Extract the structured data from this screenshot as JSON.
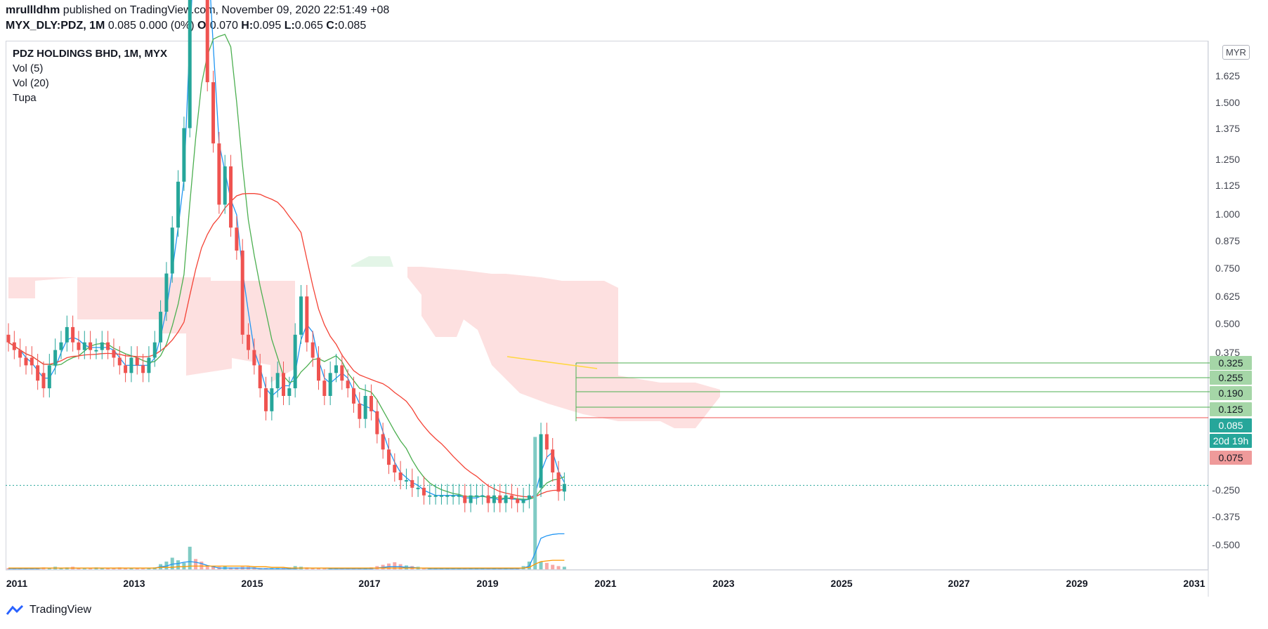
{
  "header": {
    "author": "mrullldhm",
    "published_text": "published on TradingView.com, November 09, 2020 22:51:49 +08",
    "symbol_line": "MYX_DLY:PDZ, 1M",
    "quote": "0.085 0.000 (0%)",
    "open_label": "O:",
    "open": "0.070",
    "high_label": "H:",
    "high": "0.095",
    "low_label": "L:",
    "low": "0.065",
    "close_label": "C:",
    "close": "0.085"
  },
  "legend": {
    "title": "PDZ HOLDINGS BHD, 1M, MYX",
    "vol5": "Vol (5)",
    "vol20": "Vol (20)",
    "indicator": "Tupa"
  },
  "currency_button": "MYR",
  "brand": "TradingView",
  "colors": {
    "up": "#26a69a",
    "down": "#ef5350",
    "ma_fast": "#2196f3",
    "ma_mid": "#4caf50",
    "ma_slow": "#f44336",
    "cloud_red": "#fde0e0",
    "cloud_green": "#e3f5e7",
    "level_line": "#4caf50",
    "yellow": "#ffd740"
  },
  "chart_data": {
    "type": "candlestick",
    "x_ticks": [
      "2011",
      "2013",
      "2015",
      "2017",
      "2019",
      "2021",
      "2023",
      "2025",
      "2027",
      "2029",
      "2031"
    ],
    "y_ticks": [
      "1.625",
      "1.500",
      "1.375",
      "1.250",
      "1.125",
      "1.000",
      "0.875",
      "0.750",
      "0.625",
      "0.500",
      "0.375",
      "-0.250",
      "-0.375",
      "-0.500"
    ],
    "price_labels": [
      {
        "value": "0.325",
        "kind": "level"
      },
      {
        "value": "0.255",
        "kind": "level"
      },
      {
        "value": "0.190",
        "kind": "level"
      },
      {
        "value": "0.125",
        "kind": "level"
      },
      {
        "value": "0.085",
        "kind": "last"
      },
      {
        "value": "20d 19h",
        "kind": "countdown"
      },
      {
        "value": "0.075",
        "kind": "red"
      }
    ],
    "fib_levels": [
      0.325,
      0.255,
      0.19,
      0.125
    ],
    "last_price": 0.085,
    "red_level": 0.075,
    "series": [
      {
        "name": "Price",
        "values": [
          [
            0.28,
            0.27
          ],
          [
            0.27,
            0.26
          ],
          [
            0.26,
            0.25
          ],
          [
            0.25,
            0.24
          ],
          [
            0.25,
            0.24
          ],
          [
            0.24,
            0.22
          ],
          [
            0.23,
            0.21
          ],
          [
            0.21,
            0.24
          ],
          [
            0.24,
            0.26
          ],
          [
            0.26,
            0.27
          ],
          [
            0.27,
            0.29
          ],
          [
            0.29,
            0.27
          ],
          [
            0.27,
            0.26
          ],
          [
            0.26,
            0.27
          ],
          [
            0.27,
            0.26
          ],
          [
            0.26,
            0.26
          ],
          [
            0.26,
            0.27
          ],
          [
            0.27,
            0.26
          ],
          [
            0.26,
            0.25
          ],
          [
            0.25,
            0.24
          ],
          [
            0.24,
            0.23
          ],
          [
            0.23,
            0.25
          ],
          [
            0.25,
            0.24
          ],
          [
            0.24,
            0.23
          ],
          [
            0.23,
            0.25
          ],
          [
            0.25,
            0.27
          ],
          [
            0.27,
            0.31
          ],
          [
            0.31,
            0.36
          ],
          [
            0.36,
            0.42
          ],
          [
            0.42,
            0.48
          ],
          [
            0.48,
            0.55
          ],
          [
            0.55,
            0.97
          ],
          [
            1.02,
            0.94
          ],
          [
            0.94,
            0.83
          ],
          [
            0.83,
            0.61
          ],
          [
            0.61,
            0.53
          ],
          [
            0.53,
            0.45
          ],
          [
            0.45,
            0.5
          ],
          [
            0.5,
            0.42
          ],
          [
            0.42,
            0.39
          ],
          [
            0.39,
            0.28
          ],
          [
            0.28,
            0.26
          ],
          [
            0.26,
            0.24
          ],
          [
            0.24,
            0.21
          ],
          [
            0.21,
            0.18
          ],
          [
            0.18,
            0.21
          ],
          [
            0.21,
            0.23
          ],
          [
            0.23,
            0.2
          ],
          [
            0.2,
            0.21
          ],
          [
            0.21,
            0.28
          ],
          [
            0.28,
            0.33
          ],
          [
            0.33,
            0.27
          ],
          [
            0.27,
            0.25
          ],
          [
            0.25,
            0.22
          ],
          [
            0.22,
            0.2
          ],
          [
            0.2,
            0.23
          ],
          [
            0.23,
            0.24
          ],
          [
            0.24,
            0.22
          ],
          [
            0.22,
            0.21
          ],
          [
            0.21,
            0.19
          ],
          [
            0.19,
            0.17
          ],
          [
            0.17,
            0.2
          ],
          [
            0.2,
            0.18
          ],
          [
            0.18,
            0.15
          ],
          [
            0.15,
            0.13
          ],
          [
            0.13,
            0.11
          ],
          [
            0.11,
            0.1
          ],
          [
            0.1,
            0.09
          ],
          [
            0.09,
            0.09
          ],
          [
            0.09,
            0.08
          ],
          [
            0.08,
            0.08
          ],
          [
            0.08,
            0.07
          ],
          [
            0.07,
            0.07
          ],
          [
            0.07,
            0.07
          ],
          [
            0.07,
            0.07
          ],
          [
            0.07,
            0.07
          ],
          [
            0.07,
            0.07
          ],
          [
            0.07,
            0.07
          ],
          [
            0.07,
            0.06
          ],
          [
            0.06,
            0.07
          ],
          [
            0.07,
            0.07
          ],
          [
            0.07,
            0.07
          ],
          [
            0.07,
            0.06
          ],
          [
            0.06,
            0.07
          ],
          [
            0.07,
            0.06
          ],
          [
            0.06,
            0.07
          ],
          [
            0.07,
            0.065
          ],
          [
            0.065,
            0.06
          ],
          [
            0.06,
            0.065
          ],
          [
            0.065,
            0.07
          ],
          [
            0.07,
            0.08
          ],
          [
            0.08,
            0.15
          ],
          [
            0.15,
            0.13
          ],
          [
            0.13,
            0.1
          ],
          [
            0.1,
            0.075
          ],
          [
            0.075,
            0.085
          ]
        ]
      },
      {
        "name": "Vol (5)",
        "values": [
          0.01,
          0.01,
          0.01,
          0.01,
          0.01,
          0.01,
          0.02,
          0.02,
          0.02,
          0.02,
          0.02,
          0.02,
          0.02,
          0.02,
          0.02,
          0.02,
          0.02,
          0.02,
          0.02,
          0.02,
          0.02,
          0.02,
          0.02,
          0.02,
          0.02,
          0.02,
          0.04,
          0.05,
          0.08,
          0.09,
          0.11,
          0.12,
          0.11,
          0.09,
          0.06,
          0.04,
          0.02,
          0.02,
          0.02,
          0.02,
          0.02,
          0.02,
          0.02,
          0.01,
          0.01,
          0.01,
          0.01,
          0.01,
          0.01,
          0.01,
          0.02,
          0.02,
          0.02,
          0.02,
          0.02,
          0.01,
          0.01,
          0.01,
          0.01,
          0.01,
          0.01,
          0.01,
          0.01,
          0.02,
          0.03,
          0.04,
          0.04,
          0.04,
          0.03,
          0.03,
          0.02,
          0.02,
          0.01,
          0.01,
          0.01,
          0.01,
          0.01,
          0.01,
          0.01,
          0.01,
          0.01,
          0.01,
          0.01,
          0.01,
          0.01,
          0.01,
          0.01,
          0.01,
          0.02,
          0.05,
          0.25,
          0.48,
          0.52,
          0.54,
          0.55,
          0.55
        ]
      },
      {
        "name": "Vol (20)",
        "values": [
          0.02,
          0.02,
          0.02,
          0.02,
          0.02,
          0.02,
          0.02,
          0.02,
          0.02,
          0.02,
          0.02,
          0.02,
          0.02,
          0.02,
          0.02,
          0.02,
          0.02,
          0.02,
          0.02,
          0.02,
          0.02,
          0.02,
          0.02,
          0.02,
          0.02,
          0.02,
          0.03,
          0.03,
          0.03,
          0.04,
          0.04,
          0.05,
          0.05,
          0.05,
          0.05,
          0.05,
          0.05,
          0.05,
          0.05,
          0.05,
          0.05,
          0.05,
          0.04,
          0.04,
          0.04,
          0.03,
          0.03,
          0.03,
          0.02,
          0.02,
          0.02,
          0.02,
          0.02,
          0.02,
          0.02,
          0.02,
          0.02,
          0.02,
          0.02,
          0.02,
          0.02,
          0.02,
          0.02,
          0.02,
          0.02,
          0.02,
          0.02,
          0.02,
          0.02,
          0.02,
          0.02,
          0.02,
          0.02,
          0.02,
          0.02,
          0.02,
          0.02,
          0.02,
          0.02,
          0.02,
          0.02,
          0.02,
          0.02,
          0.02,
          0.02,
          0.02,
          0.02,
          0.02,
          0.02,
          0.03,
          0.08,
          0.12,
          0.13,
          0.14,
          0.14,
          0.14
        ]
      }
    ],
    "volume": [
      0.02,
      0.02,
      0.01,
      0.02,
      0.01,
      0.02,
      0.03,
      0.02,
      0.04,
      0.02,
      0.03,
      0.04,
      0.02,
      0.01,
      0.02,
      0.03,
      0.02,
      0.02,
      0.02,
      0.03,
      0.02,
      0.02,
      0.02,
      0.01,
      0.02,
      0.03,
      0.08,
      0.12,
      0.18,
      0.14,
      0.1,
      0.35,
      0.16,
      0.12,
      0.06,
      0.05,
      0.04,
      0.05,
      0.03,
      0.03,
      0.04,
      0.04,
      0.03,
      0.02,
      0.02,
      0.02,
      0.02,
      0.02,
      0.03,
      0.05,
      0.04,
      0.03,
      0.02,
      0.02,
      0.02,
      0.02,
      0.02,
      0.02,
      0.02,
      0.02,
      0.02,
      0.02,
      0.03,
      0.05,
      0.07,
      0.09,
      0.11,
      0.08,
      0.06,
      0.05,
      0.04,
      0.02,
      0.02,
      0.01,
      0.01,
      0.01,
      0.01,
      0.01,
      0.01,
      0.01,
      0.01,
      0.01,
      0.01,
      0.01,
      0.01,
      0.01,
      0.01,
      0.01,
      0.05,
      0.12,
      2.05,
      0.12,
      0.1,
      0.07,
      0.05,
      0.04
    ],
    "xlabel": "",
    "ylabel": "",
    "grid": false,
    "legend": "top-left"
  }
}
